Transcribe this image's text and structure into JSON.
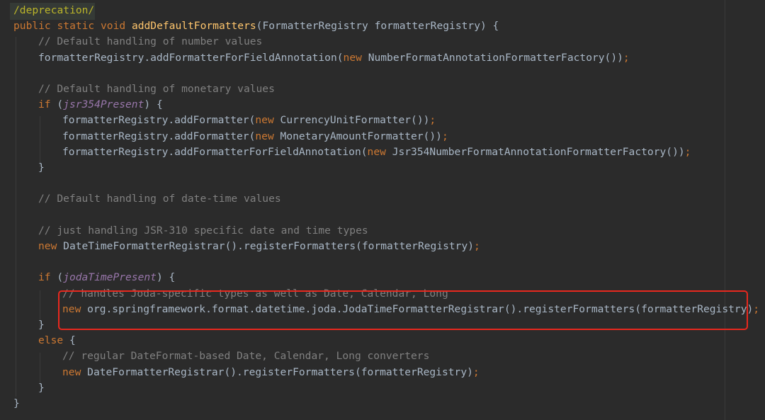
{
  "code_lines": [
    [
      [
        "ann",
        "/deprecation/"
      ]
    ],
    [
      [
        "kw",
        "public static void "
      ],
      [
        "fn",
        "addDefaultFormatters"
      ],
      [
        "pl",
        "(FormatterRegistry formatterRegistry) {"
      ]
    ],
    [
      [
        "cm",
        "// Default handling of number values"
      ]
    ],
    [
      [
        "pl",
        "formatterRegistry.addFormatterForFieldAnnotation("
      ],
      [
        "kw",
        "new "
      ],
      [
        "pl",
        "NumberFormatAnnotationFormatterFactory())"
      ],
      [
        "kw",
        ";"
      ]
    ],
    [],
    [
      [
        "cm",
        "// Default handling of monetary values"
      ]
    ],
    [
      [
        "kw",
        "if "
      ],
      [
        "pl",
        "("
      ],
      [
        "it",
        "jsr354Present"
      ],
      [
        "pl",
        ") {"
      ]
    ],
    [
      [
        "pl",
        "formatterRegistry.addFormatter("
      ],
      [
        "kw",
        "new "
      ],
      [
        "pl",
        "CurrencyUnitFormatter())"
      ],
      [
        "kw",
        ";"
      ]
    ],
    [
      [
        "pl",
        "formatterRegistry.addFormatter("
      ],
      [
        "kw",
        "new "
      ],
      [
        "pl",
        "MonetaryAmountFormatter())"
      ],
      [
        "kw",
        ";"
      ]
    ],
    [
      [
        "pl",
        "formatterRegistry.addFormatterForFieldAnnotation("
      ],
      [
        "kw",
        "new "
      ],
      [
        "pl",
        "Jsr354NumberFormatAnnotationFormatterFactory())"
      ],
      [
        "kw",
        ";"
      ]
    ],
    [
      [
        "pl",
        "}"
      ]
    ],
    [],
    [
      [
        "cm",
        "// Default handling of date-time values"
      ]
    ],
    [],
    [
      [
        "cm",
        "// just handling JSR-310 specific date and time types"
      ]
    ],
    [
      [
        "kw",
        "new "
      ],
      [
        "pl",
        "DateTimeFormatterRegistrar().registerFormatters(formatterRegistry)"
      ],
      [
        "kw",
        ";"
      ]
    ],
    [],
    [
      [
        "kw",
        "if "
      ],
      [
        "pl",
        "("
      ],
      [
        "it",
        "jodaTimePresent"
      ],
      [
        "pl",
        ") {"
      ]
    ],
    [
      [
        "cm",
        "// handles Joda-specific types as well as Date, Calendar, Long"
      ]
    ],
    [
      [
        "kw",
        "new "
      ],
      [
        "pl",
        "org.springframework.format.datetime.joda.JodaTimeFormatterRegistrar().registerFormatters(formatterRegistry)"
      ],
      [
        "kw",
        ";"
      ]
    ],
    [
      [
        "pl",
        "}"
      ]
    ],
    [
      [
        "kw",
        "else "
      ],
      [
        "pl",
        "{"
      ]
    ],
    [
      [
        "cm",
        "// regular DateFormat-based Date, Calendar, Long converters"
      ]
    ],
    [
      [
        "kw",
        "new "
      ],
      [
        "pl",
        "DateFormatterRegistrar().registerFormatters(formatterRegistry)"
      ],
      [
        "kw",
        ";"
      ]
    ],
    [
      [
        "pl",
        "}"
      ]
    ],
    [
      [
        "pl",
        "}"
      ]
    ]
  ],
  "colors": {
    "background": "#2b2b2b",
    "keyword": "#cc7832",
    "method_declaration": "#ffc66d",
    "comment": "#808080",
    "field_italic": "#9876aa",
    "annotation": "#bbb529",
    "plain": "#a9b7c6",
    "highlight_border": "#e8281e"
  }
}
